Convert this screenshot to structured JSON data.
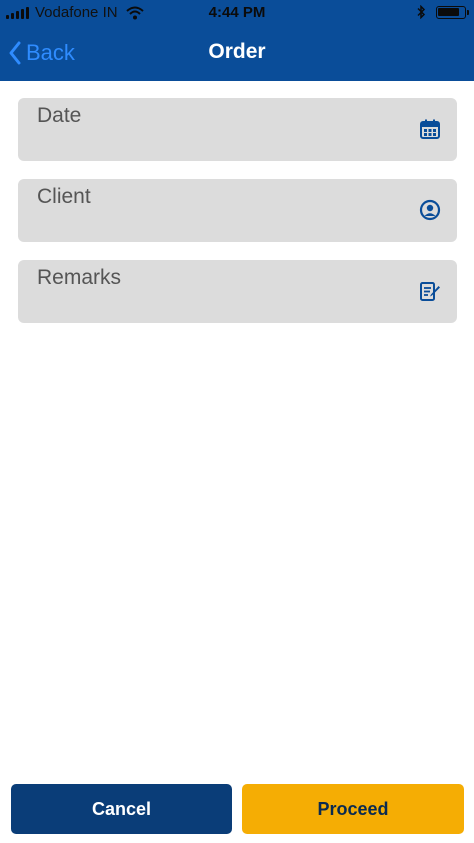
{
  "status_bar": {
    "carrier": "Vodafone IN",
    "time": "4:44 PM",
    "battery_level": 0.85
  },
  "nav": {
    "back_label": "Back",
    "title": "Order"
  },
  "form": {
    "fields": [
      {
        "label": "Date",
        "icon": "calendar-icon"
      },
      {
        "label": "Client",
        "icon": "user-circle-icon"
      },
      {
        "label": "Remarks",
        "icon": "edit-note-icon"
      }
    ]
  },
  "actions": {
    "cancel_label": "Cancel",
    "proceed_label": "Proceed"
  },
  "colors": {
    "header": "#0a4d99",
    "accent": "#2f8cff",
    "cancel": "#0a3d78",
    "proceed": "#f5ad04",
    "field": "#dcdcdc"
  }
}
